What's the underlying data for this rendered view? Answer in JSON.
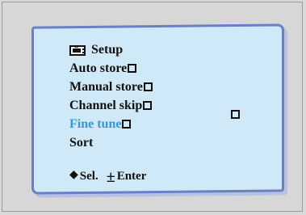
{
  "menu": {
    "title": "Setup",
    "items": [
      {
        "label": "Auto store",
        "has_box": true,
        "highlighted": false
      },
      {
        "label": "Manual store",
        "has_box": true,
        "highlighted": false
      },
      {
        "label": "Channel skip",
        "has_box": true,
        "highlighted": false
      },
      {
        "label": "Fine tune",
        "has_box": true,
        "highlighted": true
      },
      {
        "label": "Sort",
        "has_box": false,
        "highlighted": false
      }
    ]
  },
  "footer": {
    "select_label": "Sel.",
    "enter_label": "Enter"
  },
  "icons": {
    "title_icon": "tv-icon",
    "select_icon": "up-down-arrow-icon",
    "enter_icon": "plus-minus-icon",
    "box_icon": "square-box-icon"
  },
  "colors": {
    "highlight": "#2f9bd1",
    "screen_bg": "#cfe9f8",
    "screen_border": "#6b7fc7"
  }
}
